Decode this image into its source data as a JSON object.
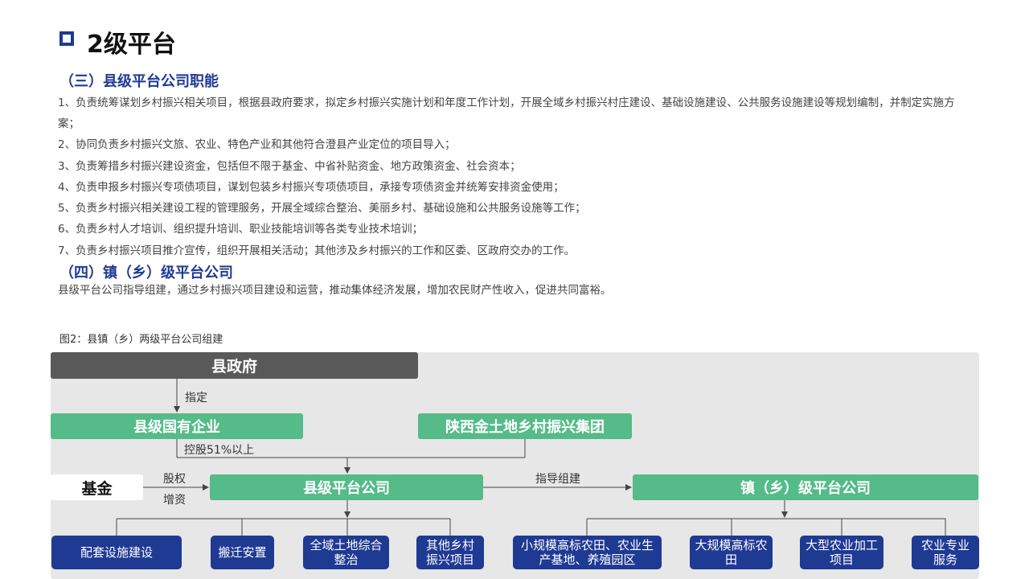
{
  "page": {
    "title": "2级平台"
  },
  "section3": {
    "heading": "（三）县级平台公司职能",
    "items": [
      "1、负责统筹谋划乡村振兴相关项目，根据县政府要求，拟定乡村振兴实施计划和年度工作计划，开展全域乡村振兴村庄建设、基础设施建设、公共服务设施建设等规划编制，并制定实施方案；",
      "2、协同负责乡村振兴文旅、农业、特色产业和其他符合澄县产业定位的项目导入；",
      "3、负责筹措乡村振兴建设资金，包括但不限于基金、中省补贴资金、地方政策资金、社会资本；",
      "4、负责申报乡村振兴专项债项目，谋划包装乡村振兴专项债项目，承接专项债资金并统筹安排资金使用；",
      "5、负责乡村振兴相关建设工程的管理服务，开展全域综合整治、美丽乡村、基础设施和公共服务设施等工作；",
      "6、负责乡村人才培训、组织提升培训、职业技能培训等各类专业技术培训；",
      "7、负责乡村振兴项目推介宣传，组织开展相关活动；其他涉及乡村振兴的工作和区委、区政府交办的工作。"
    ]
  },
  "section4": {
    "heading": "（四）镇（乡）级平台公司",
    "text": "县级平台公司指导组建，通过乡村振兴项目建设和运营，推动集体经济发展，增加农民财产性收入，促进共同富裕。"
  },
  "figure": {
    "caption": "图2：县镇（乡）两级平台公司组建",
    "nodes": {
      "county_gov": "县政府",
      "county_soe": "县级国有企业",
      "shaanxi_group": "陕西金土地乡村振兴集团",
      "fund": "基金",
      "county_platform": "县级平台公司",
      "town_platform": "镇（乡）级平台公司"
    },
    "edge_labels": {
      "designate": "指定",
      "holding": "控股51%以上",
      "equity": "股权",
      "capital": "增资",
      "guide": "指导组建"
    },
    "county_children": [
      "配套设施建设",
      "搬迁安置",
      "全域土地综合整治",
      "其他乡村振兴项目"
    ],
    "town_children": [
      "小规模高标农田、农业生产基地、养殖园区",
      "大规模高标农田",
      "大型农业加工项目",
      "农业专业服务"
    ]
  },
  "colors": {
    "navy": "#1f3a93",
    "green": "#55bb88",
    "dark_gray": "#595959",
    "panel_gray": "#e7e7e7"
  }
}
